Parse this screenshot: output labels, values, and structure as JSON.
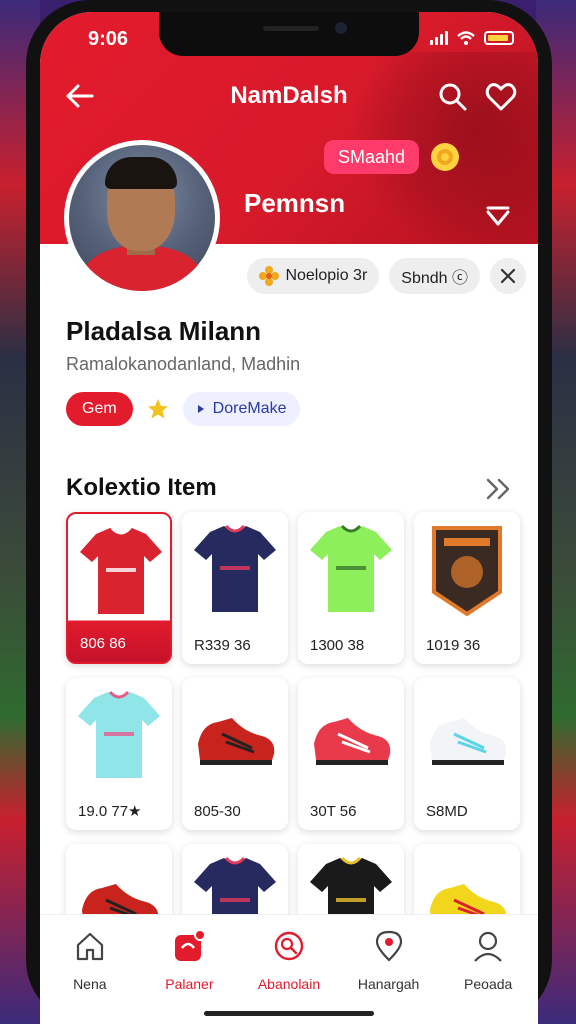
{
  "status": {
    "time": "9:06"
  },
  "topbar": {
    "title": "NamDalsh"
  },
  "hero": {
    "badge": "SMaahd",
    "name": "Pemnsn"
  },
  "chips": [
    {
      "label": "Noelopio 3r",
      "icon": "flower-icon"
    },
    {
      "label": "Sbndh ⓒ",
      "icon": ""
    }
  ],
  "profile": {
    "name": "Pladalsa Milann",
    "subtitle": "Ramalokanodanland, Madhin",
    "tag_red": "Gem",
    "tag_blue": "DoreMake"
  },
  "section": {
    "title": "Kolextio Item"
  },
  "items": [
    {
      "price": "806 86",
      "kind": "jersey",
      "color": "#d9232f",
      "stripe": "#ffffff"
    },
    {
      "price": "R339 36",
      "kind": "jersey",
      "color": "#262a5e",
      "stripe": "#e23a5a"
    },
    {
      "price": "1300 38",
      "kind": "jersey",
      "color": "#8df05a",
      "stripe": "#3a7a2a"
    },
    {
      "price": "1019 36",
      "kind": "badge",
      "color": "#3a2a22",
      "stripe": "#e07a2a"
    },
    {
      "price": "19.0 77★",
      "kind": "jersey",
      "color": "#8fe5e8",
      "stripe": "#e55a8a"
    },
    {
      "price": "805-30",
      "kind": "boot",
      "color": "#c8231d",
      "stripe": "#222222"
    },
    {
      "price": "30T 56",
      "kind": "boot",
      "color": "#e83a4a",
      "stripe": "#ffffff"
    },
    {
      "price": "S8MD",
      "kind": "boot",
      "color": "#f2f4f7",
      "stripe": "#5ad4e8"
    },
    {
      "price": "",
      "kind": "boot",
      "color": "#c8231d",
      "stripe": "#222222"
    },
    {
      "price": "",
      "kind": "jersey",
      "color": "#262a5e",
      "stripe": "#e23a5a"
    },
    {
      "price": "",
      "kind": "jersey",
      "color": "#1a1a1a",
      "stripe": "#e8c12a"
    },
    {
      "price": "",
      "kind": "boot",
      "color": "#f2d61c",
      "stripe": "#d9232f"
    }
  ],
  "nav": [
    {
      "label": "Nena",
      "icon": "home-icon"
    },
    {
      "label": "Palaner",
      "icon": "notification-app-icon"
    },
    {
      "label": "Abanolain",
      "icon": "scan-icon"
    },
    {
      "label": "Hanargah",
      "icon": "location-icon"
    },
    {
      "label": "Peoada",
      "icon": "profile-icon"
    }
  ],
  "colors": {
    "accent": "#e21b2d",
    "blue": "#2b3aa0",
    "pink": "#ff3b6b"
  }
}
